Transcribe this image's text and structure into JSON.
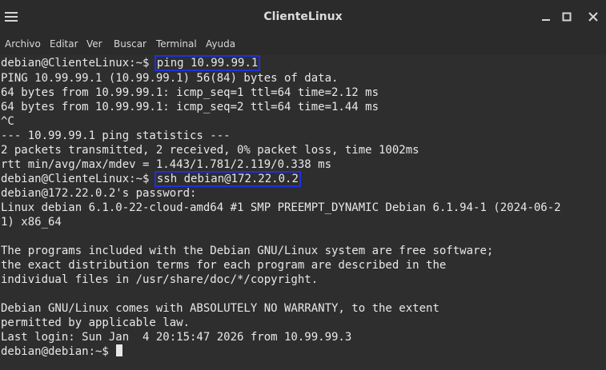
{
  "window": {
    "title": "ClienteLinux",
    "menu_icon": "hamburger-menu-icon",
    "controls": [
      "minimize-icon",
      "maximize-icon",
      "close-icon"
    ]
  },
  "menu": {
    "items": [
      "Archivo",
      "Editar",
      "Ver",
      "Buscar",
      "Terminal",
      "Ayuda"
    ]
  },
  "terminal": {
    "prompt1": "debian@ClienteLinux:~$ ",
    "cmd1": "ping 10.99.99.1",
    "out1": "PING 10.99.99.1 (10.99.99.1) 56(84) bytes of data.",
    "out2": "64 bytes from 10.99.99.1: icmp_seq=1 ttl=64 time=2.12 ms",
    "out3": "64 bytes from 10.99.99.1: icmp_seq=2 ttl=64 time=1.44 ms",
    "out4": "^C",
    "out5": "--- 10.99.99.1 ping statistics ---",
    "out6": "2 packets transmitted, 2 received, 0% packet loss, time 1002ms",
    "out7": "rtt min/avg/max/mdev = 1.443/1.781/2.119/0.338 ms",
    "prompt2": "debian@ClienteLinux:~$ ",
    "cmd2": "ssh debian@172.22.0.2",
    "out8": "debian@172.22.0.2's password:",
    "out9": "Linux debian 6.1.0-22-cloud-amd64 #1 SMP PREEMPT_DYNAMIC Debian 6.1.94-1 (2024-06-2",
    "out10": "1) x86_64",
    "out11": "The programs included with the Debian GNU/Linux system are free software;",
    "out12": "the exact distribution terms for each program are described in the",
    "out13": "individual files in /usr/share/doc/*/copyright.",
    "out14": "Debian GNU/Linux comes with ABSOLUTELY NO WARRANTY, to the extent",
    "out15": "permitted by applicable law.",
    "out16": "Last login: Sun Jan  4 20:15:47 2026 from 10.99.99.3",
    "prompt3": "debian@debian:~$ "
  },
  "colors": {
    "highlight_box": "#1f2fe0",
    "terminal_bg": "#2e2e2e",
    "text": "#e8e8e8"
  }
}
